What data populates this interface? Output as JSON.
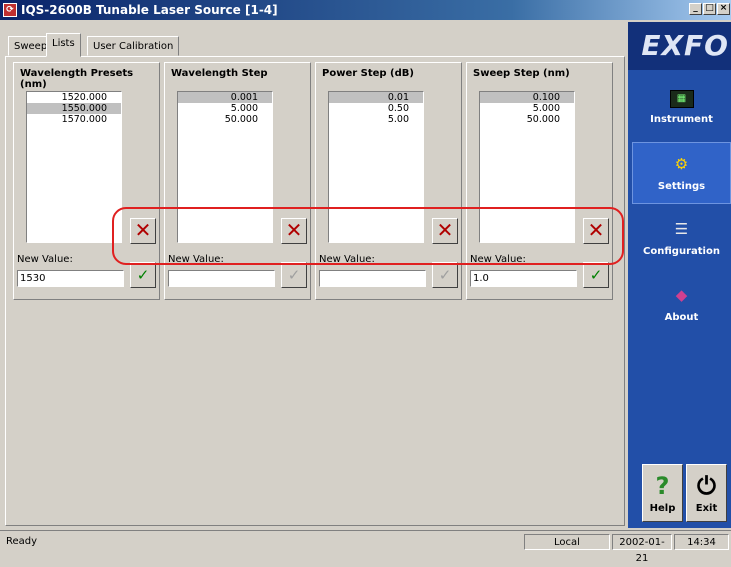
{
  "window": {
    "title": "IQS-2600B Tunable Laser Source [1-4]",
    "icon": "app-icon",
    "controls": [
      "_",
      "□",
      "×"
    ]
  },
  "tabs": [
    {
      "label": "Sweep",
      "active": false
    },
    {
      "label": "Lists",
      "active": true
    },
    {
      "label": "User Calibration",
      "active": false
    }
  ],
  "columns": [
    {
      "title": "Wavelength Presets (nm)",
      "items": [
        "1520.000",
        "1550.000",
        "1570.000"
      ],
      "selected_index": 1,
      "new_value_label": "New Value:",
      "input_value": "1530",
      "delete_icon": "x-icon",
      "confirm_icon": "check-icon",
      "confirm_enabled": true
    },
    {
      "title": "Wavelength Step",
      "items": [
        "0.001",
        "5.000",
        "50.000"
      ],
      "selected_index": 0,
      "new_value_label": "New Value:",
      "input_value": "",
      "delete_icon": "x-icon",
      "confirm_icon": "check-icon",
      "confirm_enabled": false
    },
    {
      "title": "Power Step (dB)",
      "items": [
        "0.01",
        "0.50",
        "5.00"
      ],
      "selected_index": 0,
      "new_value_label": "New Value:",
      "input_value": "",
      "delete_icon": "x-icon",
      "confirm_icon": "check-icon",
      "confirm_enabled": false
    },
    {
      "title": "Sweep Step (nm)",
      "items": [
        "0.100",
        "5.000",
        "50.000"
      ],
      "selected_index": 0,
      "new_value_label": "New Value:",
      "input_value": "1.0",
      "delete_icon": "x-icon",
      "confirm_icon": "check-icon",
      "confirm_enabled": true
    }
  ],
  "sidebar": {
    "brand": "EXFO",
    "items": [
      {
        "label": "Instrument",
        "icon": "instrument-icon",
        "active": false
      },
      {
        "label": "Settings",
        "icon": "settings-icon",
        "active": true
      },
      {
        "label": "Configuration",
        "icon": "configuration-icon",
        "active": false
      },
      {
        "label": "About",
        "icon": "about-icon",
        "active": false
      }
    ],
    "help": {
      "label": "Help",
      "icon": "help-icon"
    },
    "exit": {
      "label": "Exit",
      "icon": "power-icon"
    }
  },
  "status": {
    "message": "Ready",
    "mode": "Local",
    "date": "2002-01-21",
    "time": "14:34"
  },
  "colors": {
    "title_bar": "#0a246a",
    "sidebar": "#224fa8",
    "highlight_frame": "#e02020",
    "delete": "#b00000",
    "confirm": "#008000"
  }
}
